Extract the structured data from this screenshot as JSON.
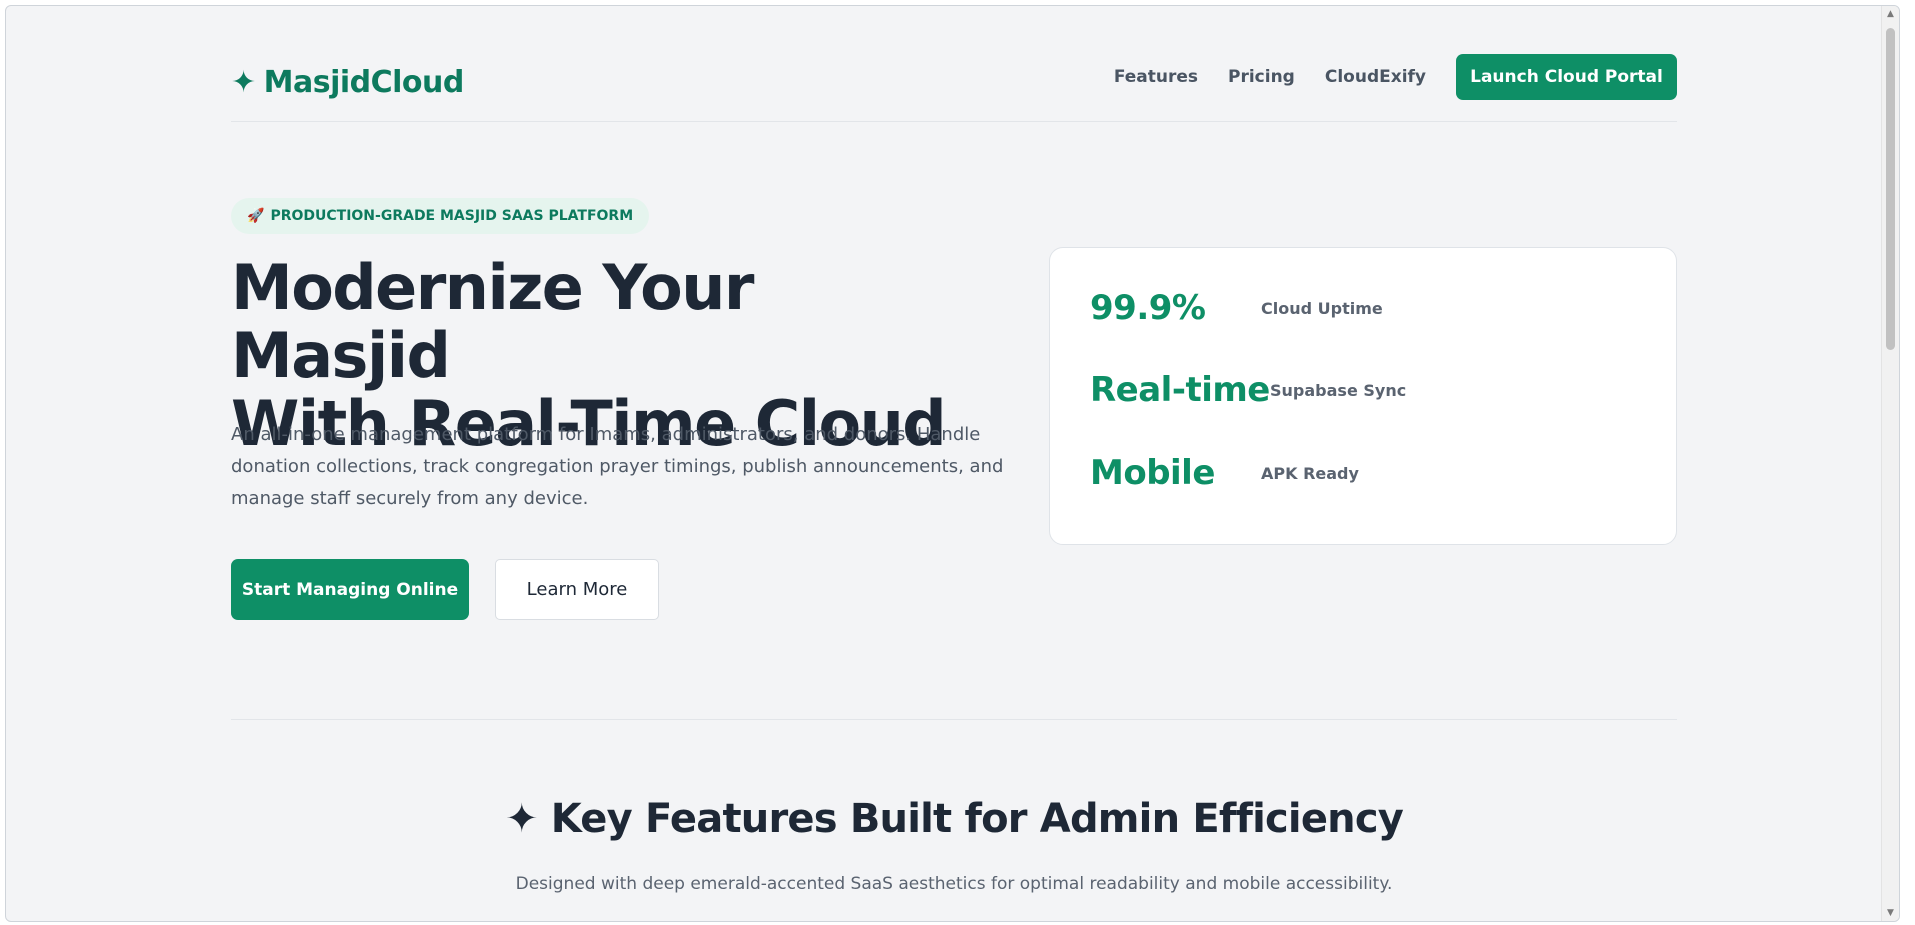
{
  "header": {
    "logo_icon": "✦",
    "logo_text": "MasjidCloud",
    "nav_links": [
      "Features",
      "Pricing",
      "CloudExify"
    ],
    "cta_label": "Launch Cloud Portal"
  },
  "hero": {
    "badge_icon": "🚀",
    "badge_text": "PRODUCTION-GRADE MASJID SAAS PLATFORM",
    "title_line1": "Modernize Your Masjid",
    "title_line2": "With Real-Time Cloud",
    "description": "An all-in-one management platform for Imams, administrators, and donors. Handle donation collections, track congregation prayer timings, publish announcements, and manage staff securely from any device.",
    "primary_button": "Start Managing Online",
    "secondary_button": "Learn More"
  },
  "stats": [
    {
      "value": "99.9%",
      "label": "Cloud Uptime"
    },
    {
      "value": "Real-time",
      "label": "Supabase Sync"
    },
    {
      "value": "Mobile",
      "label": "APK Ready"
    }
  ],
  "features": {
    "title_icon": "✦",
    "title": "Key Features Built for Admin Efficiency",
    "subtitle": "Designed with deep emerald-accented SaaS aesthetics for optimal readability and mobile accessibility."
  },
  "colors": {
    "accent": "#0e8f66",
    "heading": "#1e2836",
    "background": "#f3f4f6"
  }
}
